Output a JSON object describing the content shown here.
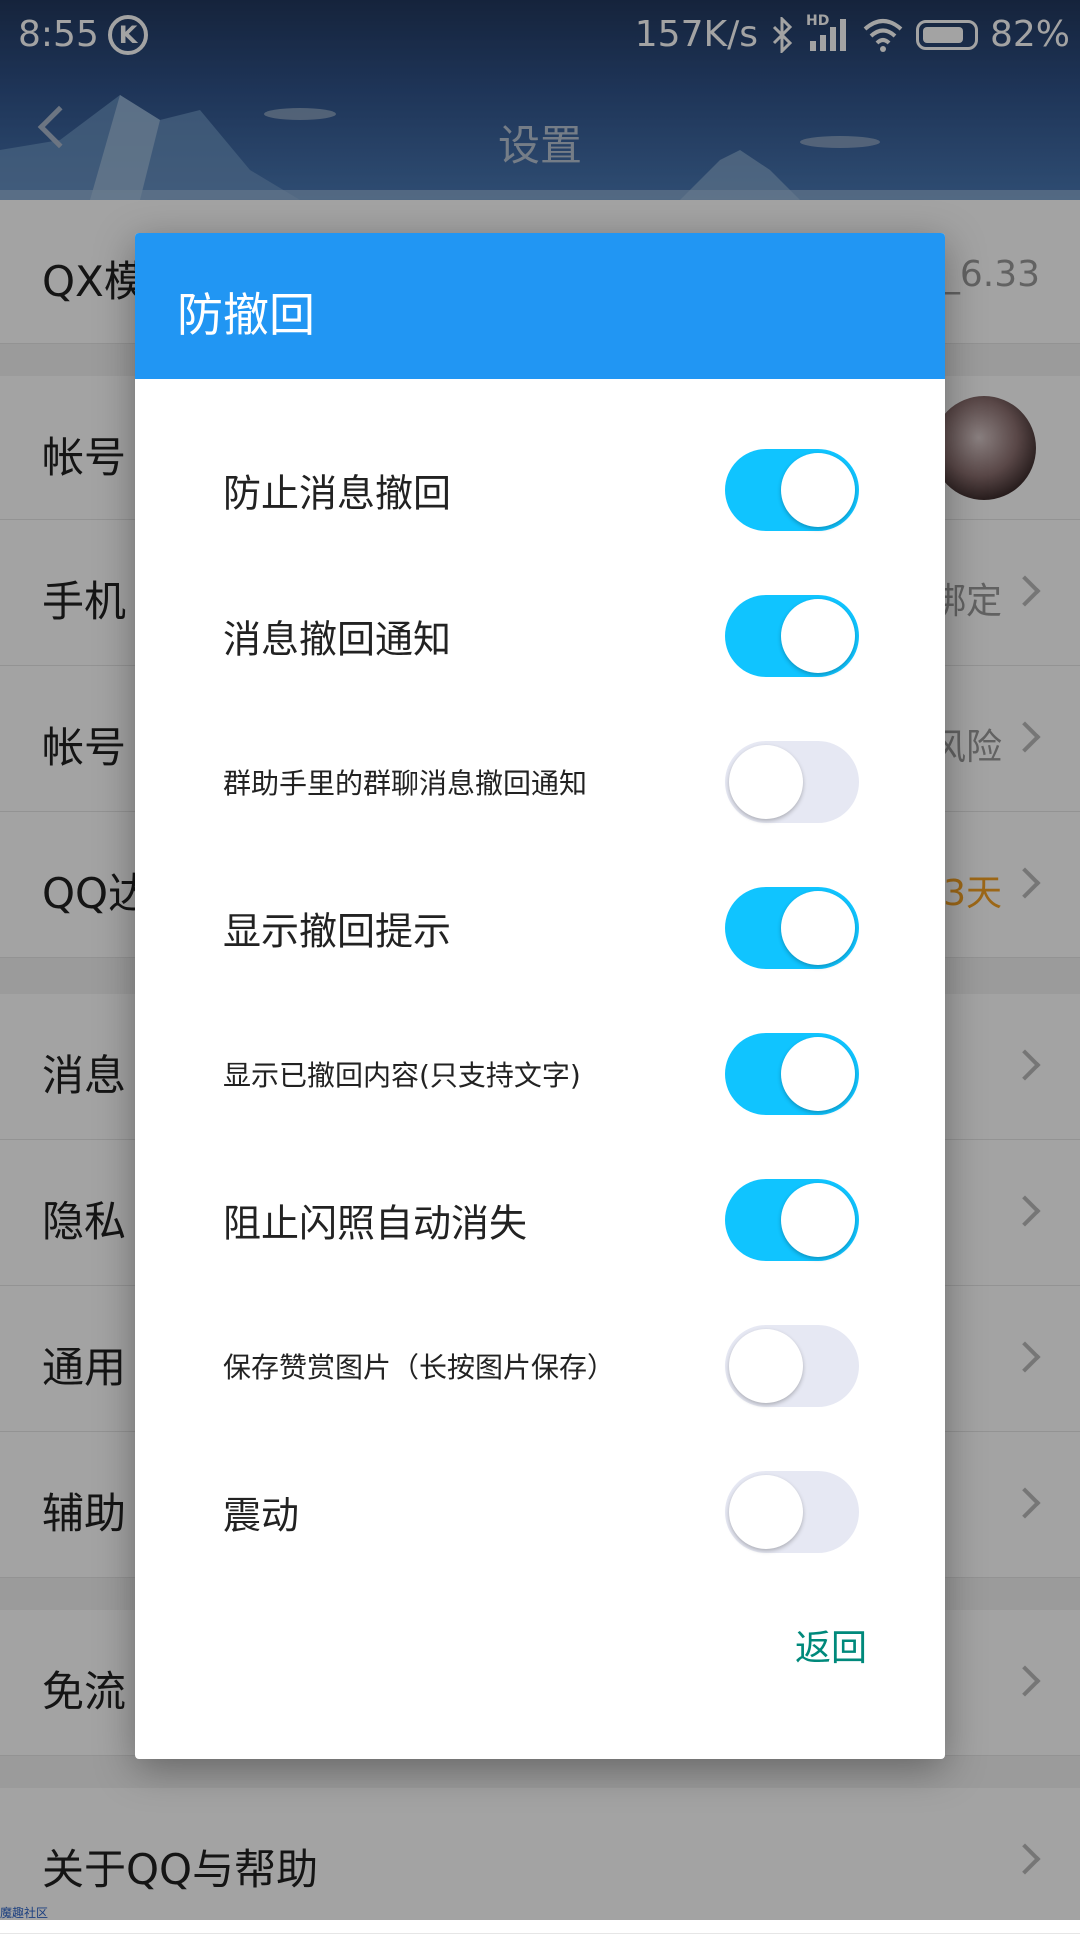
{
  "status_bar": {
    "time": "8:55",
    "k_badge": "K",
    "network_speed": "157K/s",
    "hd_label": "HD",
    "battery": "82%"
  },
  "nav": {
    "title": "设置"
  },
  "settings": {
    "rows": [
      {
        "label": "QX模",
        "value": "_6.33"
      },
      {
        "label": "帐号",
        "value": ""
      },
      {
        "label": "手机",
        "value": "绑定"
      },
      {
        "label": "帐号",
        "value": "风险"
      },
      {
        "label": "QQ达",
        "value": "3天"
      },
      {
        "label": "消息",
        "value": ""
      },
      {
        "label": "隐私",
        "value": ""
      },
      {
        "label": "通用",
        "value": ""
      },
      {
        "label": "辅助",
        "value": ""
      },
      {
        "label": "免流",
        "value": ""
      },
      {
        "label": "关于QQ与帮助",
        "value": ""
      }
    ],
    "watermark": "魔趣社区"
  },
  "dialog": {
    "title": "防撤回",
    "options": [
      {
        "label": "防止消息撤回",
        "on": true
      },
      {
        "label": "消息撤回通知",
        "on": true
      },
      {
        "label": "群助手里的群聊消息撤回通知",
        "on": false
      },
      {
        "label": "显示撤回提示",
        "on": true
      },
      {
        "label": "显示已撤回内容(只支持文字)",
        "on": true
      },
      {
        "label": "阻止闪照自动消失",
        "on": true
      },
      {
        "label": "保存赞赏图片（长按图片保存）",
        "on": false
      },
      {
        "label": "震动",
        "on": false
      }
    ],
    "back_label": "返回"
  },
  "colors": {
    "dialog_header": "#2196f3",
    "switch_on": "#10c4ff",
    "switch_off": "#e6e8f3",
    "back_text": "#00897b"
  }
}
